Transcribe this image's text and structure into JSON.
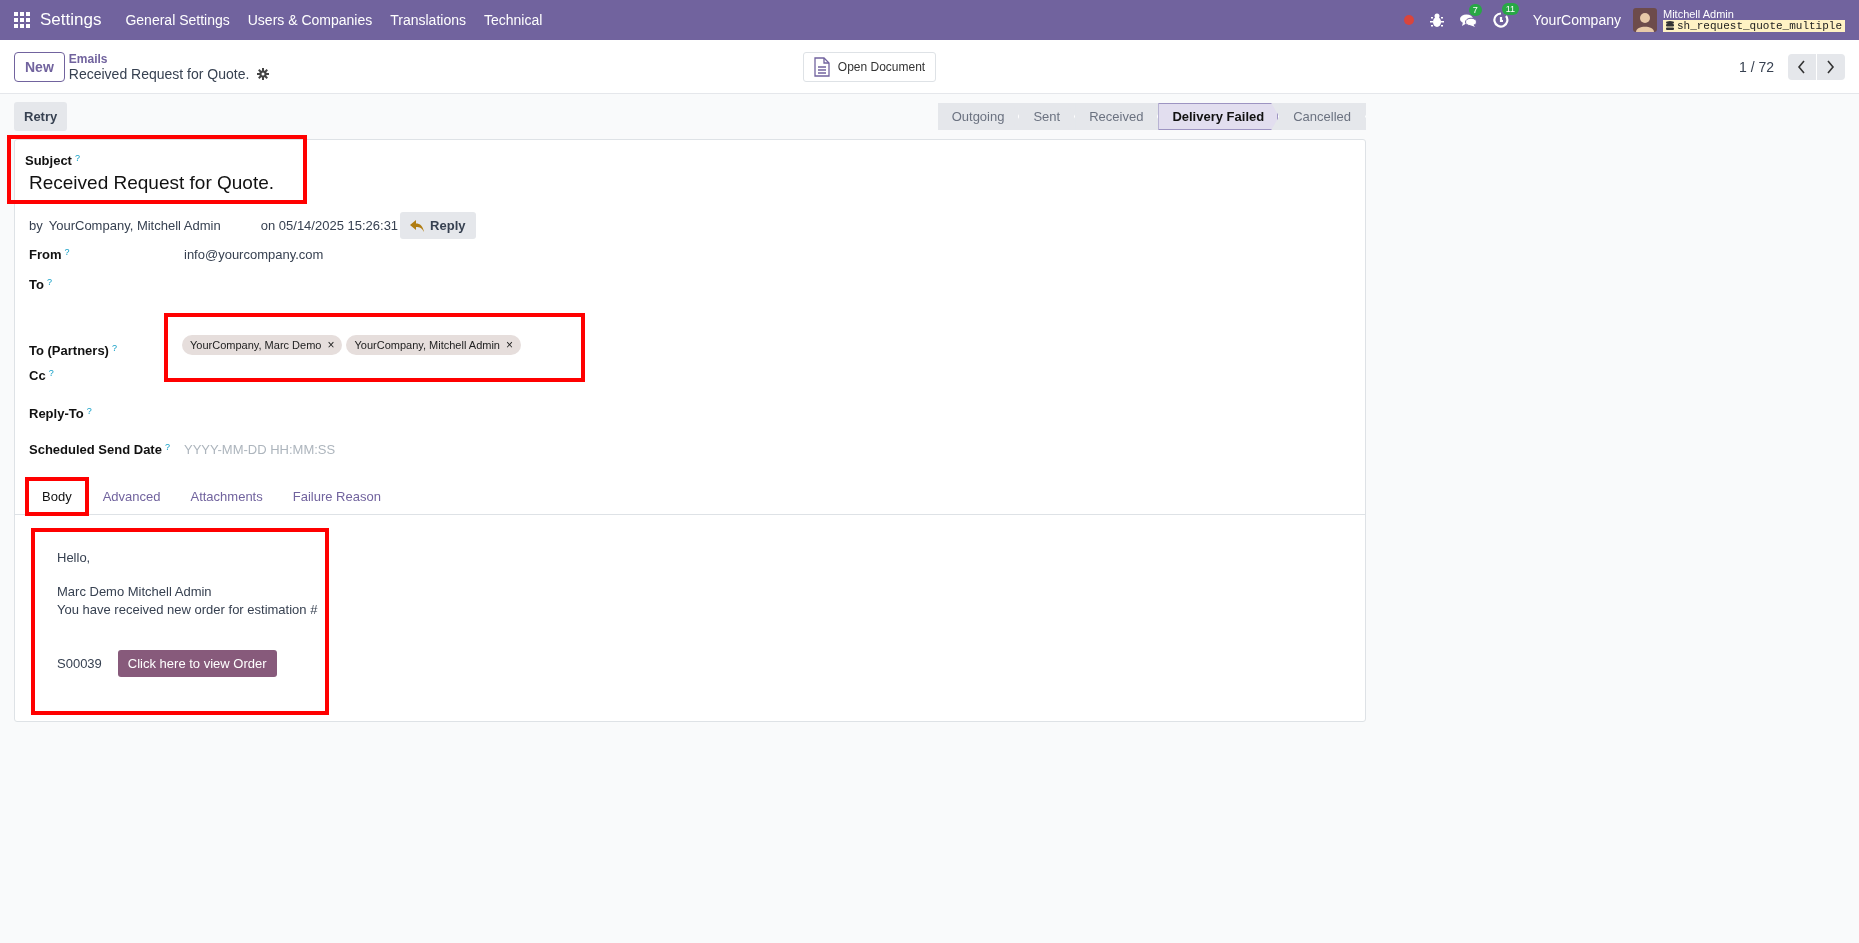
{
  "navbar": {
    "app": "Settings",
    "menus": [
      "General Settings",
      "Users & Companies",
      "Translations",
      "Technical"
    ],
    "systray": [
      {
        "kind": "dot",
        "color": "#d9453c"
      },
      {
        "kind": "bug"
      },
      {
        "kind": "chat",
        "badge": "7"
      },
      {
        "kind": "activity",
        "badge": "11"
      }
    ],
    "company": "YourCompany",
    "user": "Mitchell Admin",
    "database": "sh_request_quote_multiple"
  },
  "control_panel": {
    "new_button": "New",
    "breadcrumb": "Emails",
    "record": "Received Request for Quote.",
    "action": "Open Document",
    "pager": "1 / 72"
  },
  "header": {
    "buttons": [
      "Retry"
    ],
    "stages": [
      {
        "label": "Outgoing",
        "selected": false
      },
      {
        "label": "Sent",
        "selected": false
      },
      {
        "label": "Received",
        "selected": false
      },
      {
        "label": "Delivery Failed",
        "selected": true
      },
      {
        "label": "Cancelled",
        "selected": false
      }
    ]
  },
  "form": {
    "subject": {
      "label": "Subject",
      "help": "?",
      "value": "Received Request for Quote.",
      "highlighted": true
    },
    "by": "by",
    "author": "YourCompany, Mitchell Admin",
    "date": "on 05/14/2025 15:26:31",
    "reply_button": "Reply",
    "fields": [
      {
        "kind": "text",
        "label": "From",
        "help": "?",
        "value": "info@yourcompany.com"
      },
      {
        "kind": "text",
        "label": "To",
        "help": "?"
      },
      {
        "kind": "tags",
        "label": "To (Partners)",
        "help": "?",
        "highlighted": true,
        "tags": [
          {
            "label": "YourCompany, Marc Demo",
            "remove": "×"
          },
          {
            "label": "YourCompany, Mitchell Admin",
            "remove": "×"
          }
        ]
      },
      {
        "kind": "text",
        "label": "Cc",
        "help": "?"
      },
      {
        "kind": "text",
        "label": "Reply-To",
        "help": "?"
      },
      {
        "kind": "date",
        "label": "Scheduled Send Date",
        "help": "?",
        "placeholder": "YYYY-MM-DD HH:MM:SS"
      }
    ],
    "tabs": [
      {
        "label": "Body",
        "selected": true,
        "highlighted": true
      },
      {
        "label": "Advanced",
        "selected": false,
        "highlighted": false
      },
      {
        "label": "Attachments",
        "selected": false,
        "highlighted": false
      },
      {
        "label": "Failure Reason",
        "selected": false,
        "highlighted": false
      }
    ],
    "body": {
      "highlighted": true,
      "greeting": "Hello,",
      "names": "Marc Demo Mitchell Admin",
      "message": "You have received new order for estimation #",
      "order": "S00039",
      "button": "Click here to view Order"
    }
  }
}
